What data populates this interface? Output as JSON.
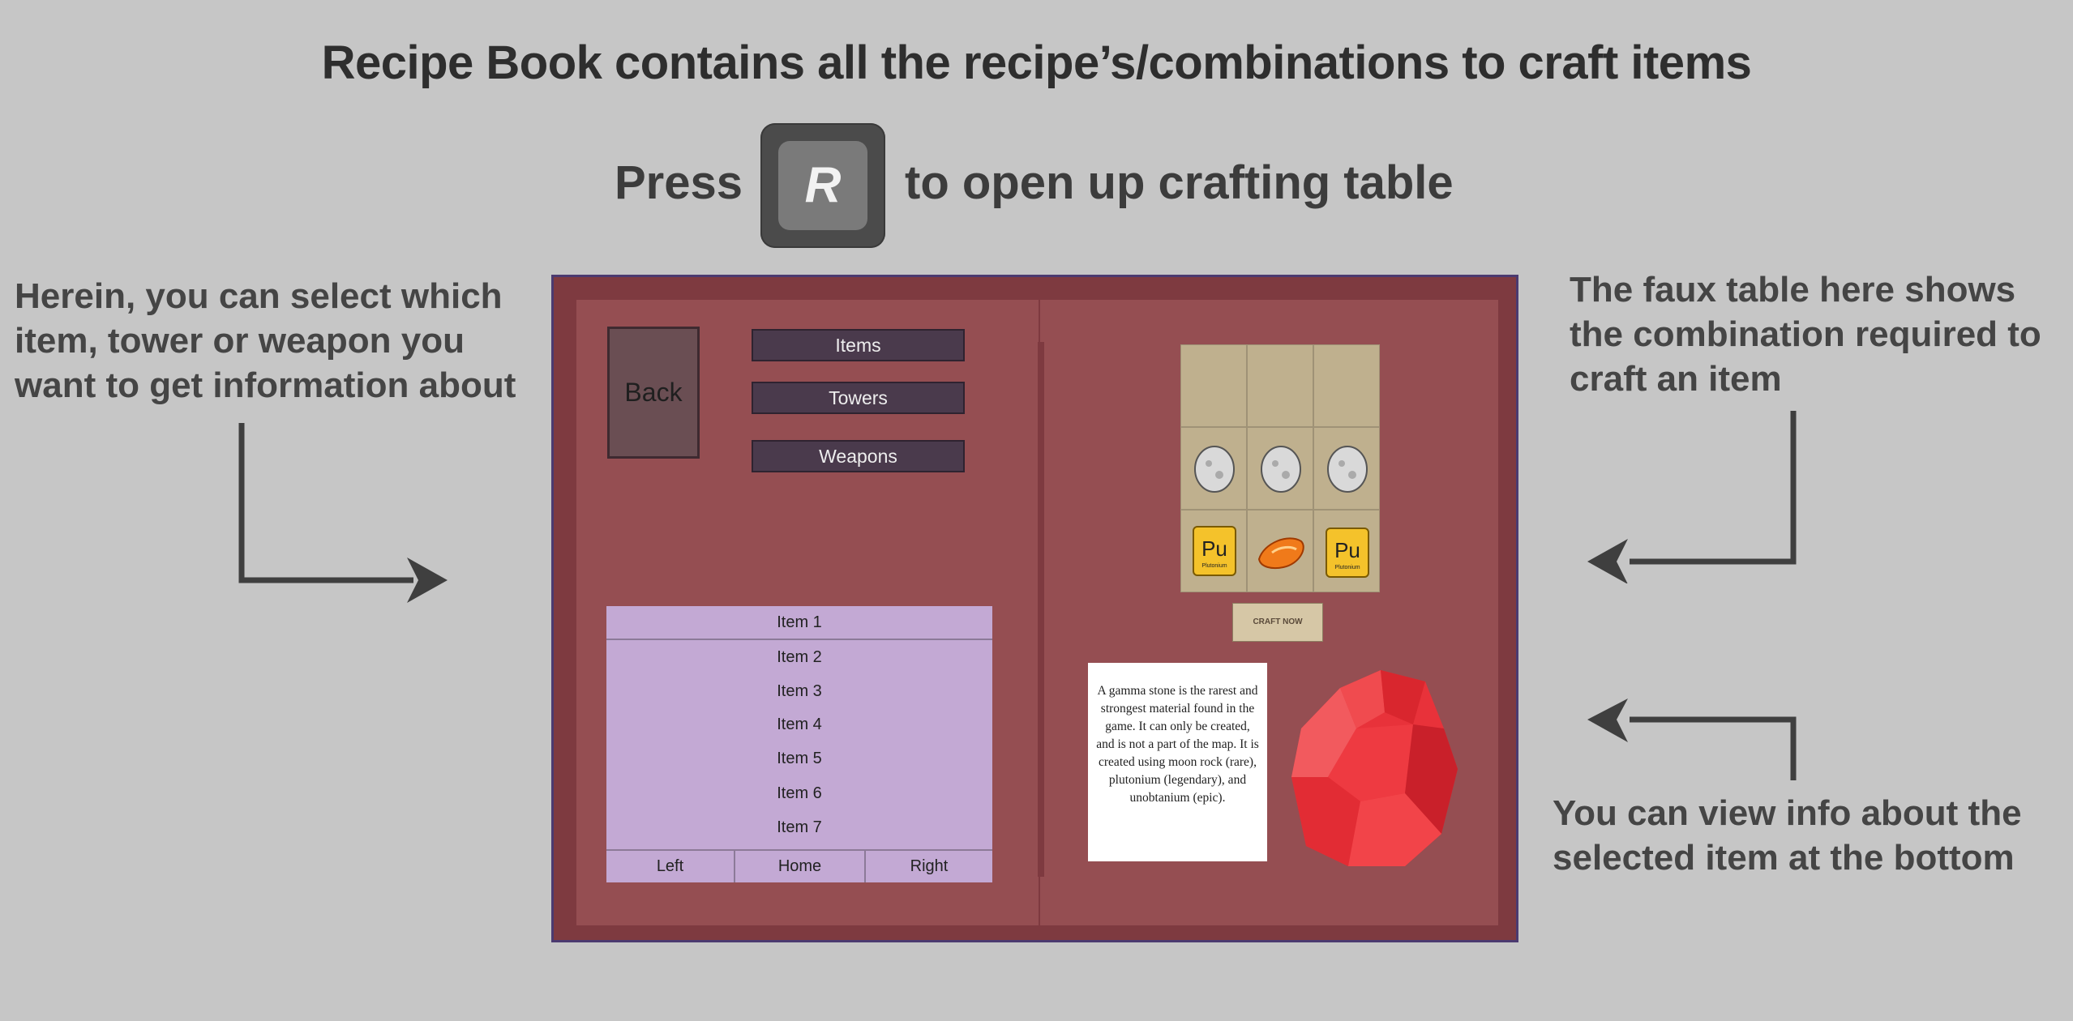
{
  "header": {
    "title": "Recipe Book contains all the recipe’s/combinations to craft items",
    "press": "Press",
    "key": "R",
    "press_rest": "to open up crafting table"
  },
  "notes": {
    "left": "Herein, you can select which item, tower or weapon you want to get information about",
    "right_top": "The faux table here shows the combination required to craft an item",
    "right_bottom": "You can view info about the selected item at the bottom"
  },
  "book": {
    "back_label": "Back",
    "categories": [
      "Items",
      "Towers",
      "Weapons"
    ],
    "list_header": "Item 1",
    "list_items": [
      "Item 2",
      "Item 3",
      "Item 4",
      "Item 5",
      "Item 6",
      "Item 7"
    ],
    "nav": [
      "Left",
      "Home",
      "Right"
    ],
    "craft_button": "CRAFT NOW",
    "element_symbol": "Pu",
    "element_name": "Plutonium",
    "info_text": "A gamma stone is the rarest and strongest material found in the game. It can only be created, and is not a part of the map. It is created using moon rock (rare), plutonium (legendary), and unobtanium (epic)."
  },
  "colors": {
    "background": "#c6c6c6",
    "book": "#7e3a40",
    "page": "#954e52",
    "list": "#c3a9d4",
    "gem": "#e8323a"
  }
}
